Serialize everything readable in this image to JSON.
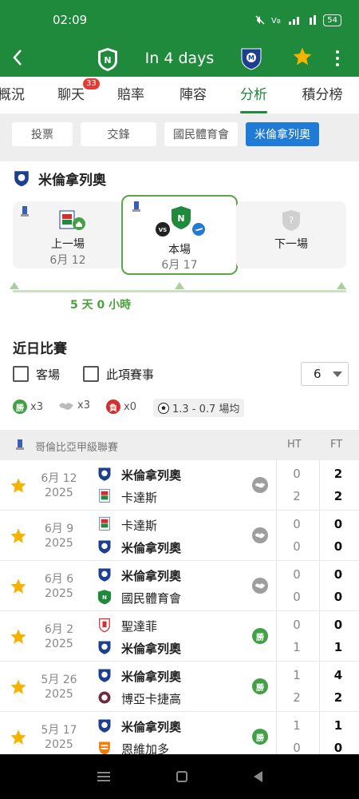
{
  "status_bar": {
    "time": "02:09",
    "icons": [
      "mute-icon",
      "volte-icon",
      "signal-4g-icon",
      "wifi-icon"
    ],
    "battery": "54"
  },
  "app_bar": {
    "title": "In 4 days",
    "home_team_crest": "atletico-nacional-crest",
    "away_team_crest": "millonarios-crest"
  },
  "tabs": [
    {
      "label": "概況"
    },
    {
      "label": "聊天",
      "badge": "33"
    },
    {
      "label": "賠率"
    },
    {
      "label": "陣容"
    },
    {
      "label": "分析",
      "active": true
    },
    {
      "label": "積分榜"
    }
  ],
  "subtabs": [
    {
      "label": "投票"
    },
    {
      "label": "交鋒"
    },
    {
      "label": "國民體育會"
    },
    {
      "label": "米倫拿列奧",
      "active": true
    }
  ],
  "team_section": {
    "team_name": "米倫拿列奧",
    "cards": {
      "previous": {
        "label": "上一場",
        "date": "6月 12"
      },
      "current": {
        "label": "本場",
        "date": "6月 17"
      },
      "next": {
        "label": "下一場"
      }
    },
    "countdown": "5 天 0 小時"
  },
  "recent": {
    "title": "近日比賽",
    "filters": {
      "away_label": "客場",
      "competition_label": "此項賽事",
      "count": "6"
    },
    "summary": {
      "wins": "x3",
      "draws": "x3",
      "losses": "x0",
      "win_letter": "勝",
      "loss_letter": "負",
      "goals": "1.3 - 0.7 場均"
    },
    "league": {
      "name": "哥倫比亞甲級聯賽",
      "ht_label": "HT",
      "ft_label": "FT"
    },
    "matches": [
      {
        "date": "6月 12",
        "year": "2025",
        "home": "米倫拿列奧",
        "away": "卡達斯",
        "home_bold": true,
        "away_bold": false,
        "result": "draw",
        "ht_home": "0",
        "ht_away": "2",
        "ft_home": "2",
        "ft_away": "2"
      },
      {
        "date": "6月 9",
        "year": "2025",
        "home": "卡達斯",
        "away": "米倫拿列奧",
        "home_bold": false,
        "away_bold": true,
        "result": "draw",
        "ht_home": "0",
        "ht_away": "0",
        "ft_home": "0",
        "ft_away": "0"
      },
      {
        "date": "6月 6",
        "year": "2025",
        "home": "米倫拿列奧",
        "away": "國民體育會",
        "home_bold": true,
        "away_bold": false,
        "result": "draw",
        "ht_home": "0",
        "ht_away": "0",
        "ft_home": "0",
        "ft_away": "0"
      },
      {
        "date": "6月 2",
        "year": "2025",
        "home": "聖達菲",
        "away": "米倫拿列奧",
        "home_bold": false,
        "away_bold": true,
        "result": "win",
        "result_letter": "勝",
        "ht_home": "0",
        "ht_away": "1",
        "ft_home": "0",
        "ft_away": "1"
      },
      {
        "date": "5月 26",
        "year": "2025",
        "home": "米倫拿列奧",
        "away": "博亞卡捷高",
        "home_bold": true,
        "away_bold": false,
        "result": "win",
        "result_letter": "勝",
        "ht_home": "1",
        "ht_away": "2",
        "ft_home": "4",
        "ft_away": "2"
      },
      {
        "date": "5月 17",
        "year": "2025",
        "home": "米倫拿列奧",
        "away": "恩維加多",
        "home_bold": true,
        "away_bold": false,
        "result": "win",
        "result_letter": "勝",
        "ht_home": "1",
        "ht_away": "0",
        "ft_home": "1",
        "ft_away": "0"
      }
    ]
  },
  "colors": {
    "brand_green": "#1f8a3c",
    "active_blue": "#1f7bd6",
    "win": "#43a047",
    "loss": "#d32f2f",
    "draw": "#9e9e9e",
    "star": "#f5b301"
  }
}
